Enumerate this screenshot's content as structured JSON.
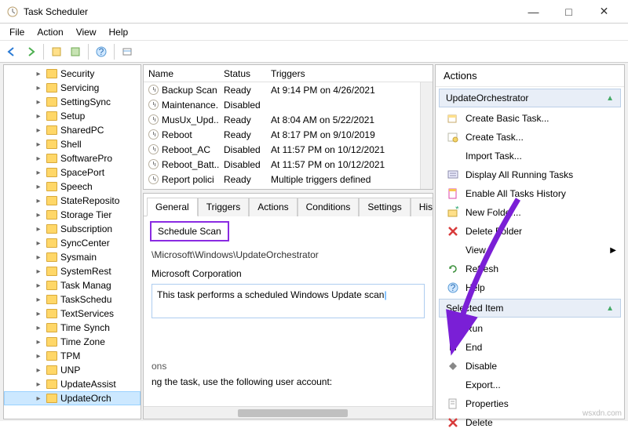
{
  "window": {
    "title": "Task Scheduler",
    "min": "—",
    "max": "□",
    "close": "✕"
  },
  "menu": [
    "File",
    "Action",
    "View",
    "Help"
  ],
  "tree": {
    "items": [
      "Security",
      "Servicing",
      "SettingSync",
      "Setup",
      "SharedPC",
      "Shell",
      "SoftwarePro",
      "SpacePort",
      "Speech",
      "StateReposito",
      "Storage Tier",
      "Subscription",
      "SyncCenter",
      "Sysmain",
      "SystemRest",
      "Task Manag",
      "TaskSchedu",
      "TextServices",
      "Time Synch",
      "Time Zone",
      "TPM",
      "UNP",
      "UpdateAssist",
      "UpdateOrch"
    ]
  },
  "tasks": {
    "columns": [
      "Name",
      "Status",
      "Triggers"
    ],
    "rows": [
      {
        "name": "Backup Scan",
        "status": "Ready",
        "trigger": "At 9:14 PM on 4/26/2021"
      },
      {
        "name": "Maintenance...",
        "status": "Disabled",
        "trigger": ""
      },
      {
        "name": "MusUx_Upd...",
        "status": "Ready",
        "trigger": "At 8:04 AM on 5/22/2021"
      },
      {
        "name": "Reboot",
        "status": "Ready",
        "trigger": "At 8:17 PM on 9/10/2019"
      },
      {
        "name": "Reboot_AC",
        "status": "Disabled",
        "trigger": "At 11:57 PM on 10/12/2021"
      },
      {
        "name": "Reboot_Batt...",
        "status": "Disabled",
        "trigger": "At 11:57 PM on 10/12/2021"
      },
      {
        "name": "Report polici",
        "status": "Ready",
        "trigger": "Multiple triggers defined"
      }
    ]
  },
  "detail": {
    "tabs": [
      "General",
      "Triggers",
      "Actions",
      "Conditions",
      "Settings",
      "Hist"
    ],
    "task_name": "Schedule Scan",
    "location": "\\Microsoft\\Windows\\UpdateOrchestrator",
    "author": "Microsoft Corporation",
    "description": "This task performs a scheduled Windows Update scan",
    "sec_label": "ons",
    "user_label": "ng the task, use the following user account:"
  },
  "actions": {
    "title": "Actions",
    "group1": "UpdateOrchestrator",
    "items1": [
      {
        "label": "Create Basic Task...",
        "icon": "create-basic"
      },
      {
        "label": "Create Task...",
        "icon": "create"
      },
      {
        "label": "Import Task...",
        "icon": "import"
      },
      {
        "label": "Display All Running Tasks",
        "icon": "display"
      },
      {
        "label": "Enable All Tasks History",
        "icon": "enable"
      },
      {
        "label": "New Folder...",
        "icon": "newfolder"
      },
      {
        "label": "Delete Folder",
        "icon": "deletefolder"
      },
      {
        "label": "View",
        "icon": "view",
        "sub": true
      },
      {
        "label": "Refresh",
        "icon": "refresh"
      },
      {
        "label": "Help",
        "icon": "help"
      }
    ],
    "group2": "Selected Item",
    "items2": [
      {
        "label": "Run",
        "icon": "run"
      },
      {
        "label": "End",
        "icon": "end"
      },
      {
        "label": "Disable",
        "icon": "disable"
      },
      {
        "label": "Export...",
        "icon": "export"
      },
      {
        "label": "Properties",
        "icon": "properties"
      },
      {
        "label": "Delete",
        "icon": "delete"
      }
    ]
  },
  "watermark": "wsxdn.com"
}
